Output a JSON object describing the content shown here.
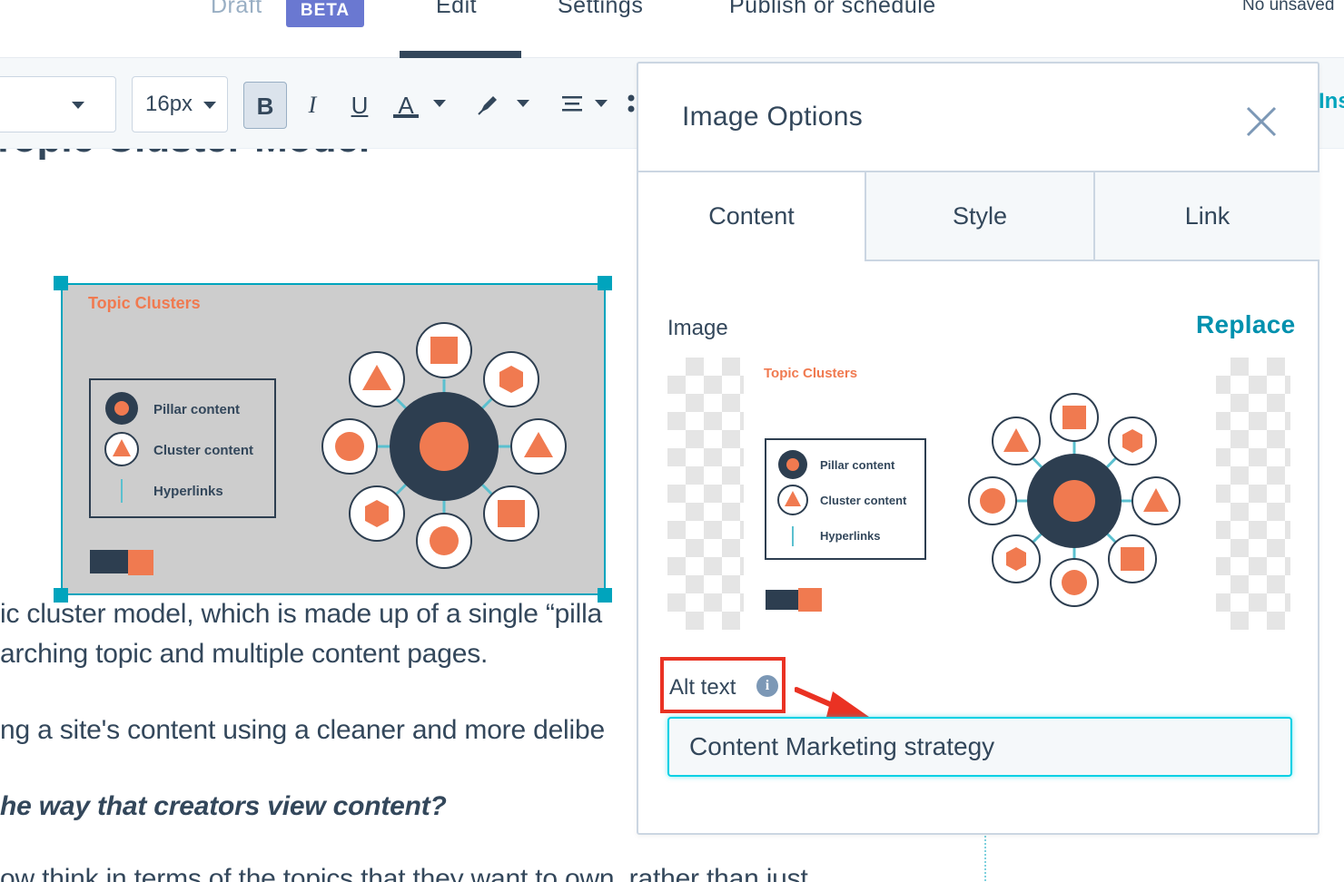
{
  "nav": {
    "draft_label": "Draft",
    "beta_badge": "BETA",
    "edit_label": "Edit",
    "settings_label": "Settings",
    "publish_label": "Publish or schedule",
    "status_text": "No unsaved"
  },
  "toolbar": {
    "font_size": "16px",
    "bold_label": "B",
    "italic_label": "I",
    "underline_label": "U",
    "text_color_label": "A",
    "insert_label": "Inser"
  },
  "editor": {
    "heading": "Topic Cluster Model",
    "paragraphs": [
      "ic cluster model, which is made up of a single “pilla",
      "arching topic and multiple content pages.",
      "ng a site's content using a cleaner and more delibe",
      "he way that creators view content?",
      "ow think in terms of the topics that they want to own, rather than just"
    ]
  },
  "figure": {
    "title": "Topic Clusters",
    "legend": [
      "Pillar content",
      "Cluster content",
      "Hyperlinks"
    ],
    "accent_color": "#f07a50",
    "hub_color": "#2d3e50",
    "link_color": "#5bc0cf"
  },
  "panel": {
    "title": "Image Options",
    "tabs": [
      "Content",
      "Style",
      "Link"
    ],
    "image_label": "Image",
    "replace_label": "Replace",
    "alt_text_label": "Alt text",
    "alt_text_value": "Content Marketing strategy",
    "accent_color": "#0091ae",
    "highlight_color": "#ea3223"
  }
}
